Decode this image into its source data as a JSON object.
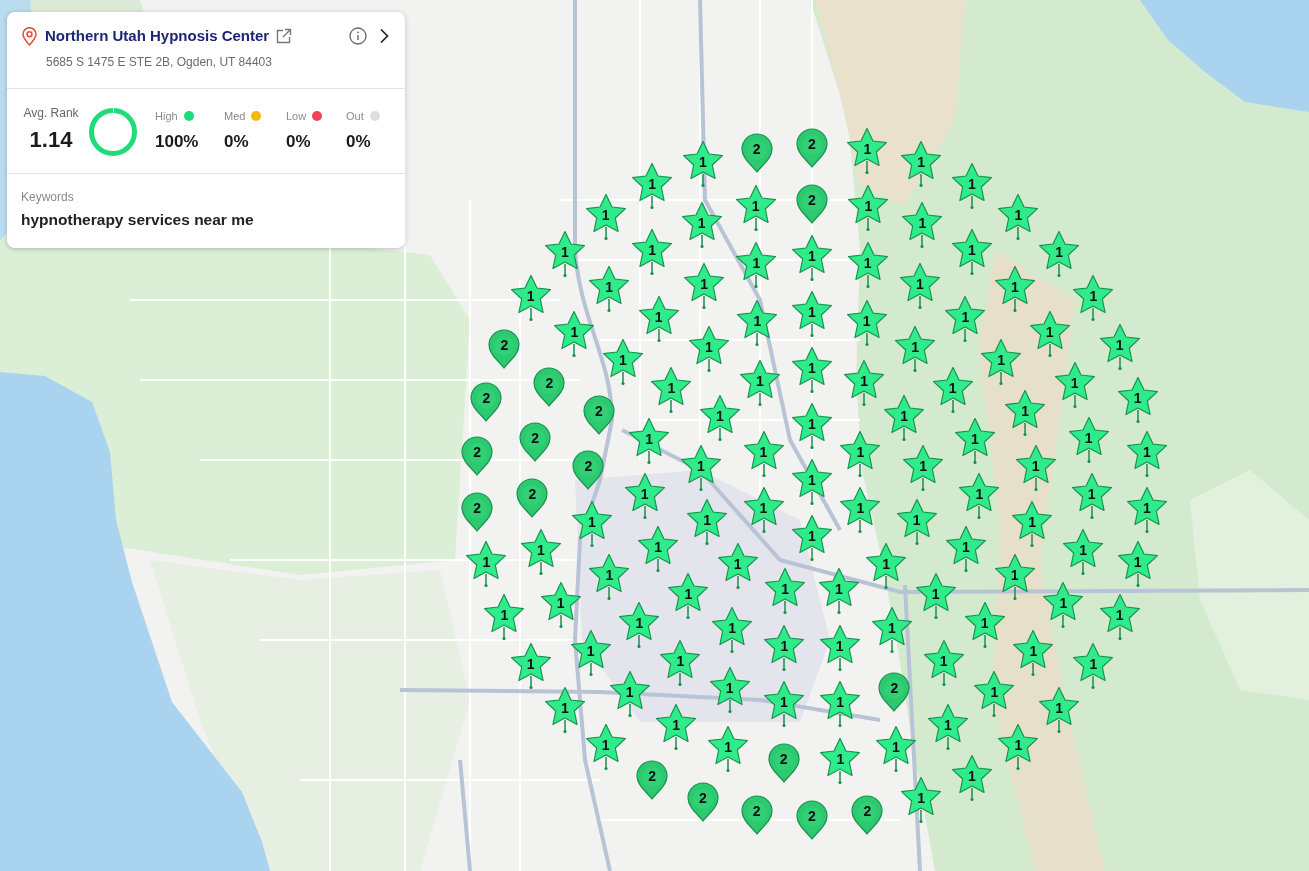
{
  "business": {
    "name": "Northern Utah Hypnosis Center",
    "address": "5685 S 1475 E STE 2B, Ogden, UT 84403"
  },
  "summary": {
    "avg_rank_label": "Avg. Rank",
    "avg_rank": "1.14",
    "donut": {
      "segments": [
        {
          "color": "#1fdc78",
          "level": 1
        }
      ]
    },
    "stats": [
      {
        "label": "High",
        "color": "#1fdc78",
        "value": "100%"
      },
      {
        "label": "Med",
        "color": "#f6b90c",
        "value": "0%"
      },
      {
        "label": "Low",
        "color": "#ee4455",
        "value": "0%"
      },
      {
        "label": "Out",
        "color": "#dcdde3",
        "value": "0%"
      }
    ]
  },
  "keywords": {
    "label": "Keywords",
    "value": "hypnotherapy services near me"
  },
  "map": {
    "rings": [
      {
        "points": [
          {
            "kind": "star",
            "label": "1"
          }
        ]
      },
      {
        "points": [
          {
            "kind": "star",
            "label": "1"
          },
          {
            "kind": "star",
            "label": "1"
          },
          {
            "kind": "star",
            "label": "1"
          },
          {
            "kind": "star",
            "label": "1"
          },
          {
            "kind": "star",
            "label": "1"
          },
          {
            "kind": "star",
            "label": "1"
          }
        ]
      },
      {
        "points": [
          {
            "kind": "star",
            "label": "1"
          },
          {
            "kind": "star",
            "label": "1"
          },
          {
            "kind": "star",
            "label": "1"
          },
          {
            "kind": "star",
            "label": "1"
          },
          {
            "kind": "star",
            "label": "1"
          },
          {
            "kind": "star",
            "label": "1"
          },
          {
            "kind": "star",
            "label": "1"
          },
          {
            "kind": "star",
            "label": "1"
          },
          {
            "kind": "star",
            "label": "1"
          },
          {
            "kind": "star",
            "label": "1"
          },
          {
            "kind": "star",
            "label": "1"
          },
          {
            "kind": "star",
            "label": "1"
          },
          {
            "kind": "star",
            "label": "1"
          }
        ]
      },
      {
        "points": [
          {
            "kind": "star",
            "label": "1"
          },
          {
            "kind": "star",
            "label": "1"
          },
          {
            "kind": "star",
            "label": "1"
          },
          {
            "kind": "star",
            "label": "1"
          },
          {
            "kind": "star",
            "label": "1"
          },
          {
            "kind": "star",
            "label": "1"
          },
          {
            "kind": "star",
            "label": "1"
          },
          {
            "kind": "star",
            "label": "1"
          },
          {
            "kind": "star",
            "label": "1"
          },
          {
            "kind": "star",
            "label": "1"
          },
          {
            "kind": "star",
            "label": "1"
          },
          {
            "kind": "star",
            "label": "1"
          },
          {
            "kind": "star",
            "label": "1"
          },
          {
            "kind": "star",
            "label": "1"
          },
          {
            "kind": "star",
            "label": "1"
          },
          {
            "kind": "star",
            "label": "1"
          },
          {
            "kind": "star",
            "label": "1"
          },
          {
            "kind": "star",
            "label": "1"
          },
          {
            "kind": "star",
            "label": "1"
          }
        ]
      },
      {
        "points": [
          {
            "kind": "star",
            "label": "1"
          },
          {
            "kind": "star",
            "label": "1"
          },
          {
            "kind": "star",
            "label": "1"
          },
          {
            "kind": "star",
            "label": "1"
          },
          {
            "kind": "star",
            "label": "1"
          },
          {
            "kind": "star",
            "label": "1"
          },
          {
            "kind": "star",
            "label": "1"
          },
          {
            "kind": "star",
            "label": "1"
          },
          {
            "kind": "star",
            "label": "1"
          },
          {
            "kind": "star",
            "label": "1"
          },
          {
            "kind": "star",
            "label": "1"
          },
          {
            "kind": "pin",
            "label": "2"
          },
          {
            "kind": "star",
            "label": "1"
          },
          {
            "kind": "star",
            "label": "1"
          },
          {
            "kind": "star",
            "label": "1"
          },
          {
            "kind": "star",
            "label": "1"
          },
          {
            "kind": "star",
            "label": "1"
          },
          {
            "kind": "star",
            "label": "1"
          },
          {
            "kind": "star",
            "label": "1"
          },
          {
            "kind": "pin",
            "label": "2"
          },
          {
            "kind": "pin",
            "label": "2"
          },
          {
            "kind": "star",
            "label": "1"
          },
          {
            "kind": "star",
            "label": "1"
          },
          {
            "kind": "star",
            "label": "1"
          },
          {
            "kind": "star",
            "label": "1"
          }
        ]
      },
      {
        "points": [
          {
            "kind": "pin",
            "label": "2"
          },
          {
            "kind": "star",
            "label": "1"
          },
          {
            "kind": "star",
            "label": "1"
          },
          {
            "kind": "star",
            "label": "1"
          },
          {
            "kind": "star",
            "label": "1"
          },
          {
            "kind": "star",
            "label": "1"
          },
          {
            "kind": "star",
            "label": "1"
          },
          {
            "kind": "star",
            "label": "1"
          },
          {
            "kind": "star",
            "label": "1"
          },
          {
            "kind": "star",
            "label": "1"
          },
          {
            "kind": "star",
            "label": "1"
          },
          {
            "kind": "star",
            "label": "1"
          },
          {
            "kind": "star",
            "label": "1"
          },
          {
            "kind": "star",
            "label": "1"
          },
          {
            "kind": "star",
            "label": "1"
          },
          {
            "kind": "star",
            "label": "1"
          },
          {
            "kind": "pin",
            "label": "2"
          },
          {
            "kind": "star",
            "label": "1"
          },
          {
            "kind": "star",
            "label": "1"
          },
          {
            "kind": "star",
            "label": "1"
          },
          {
            "kind": "star",
            "label": "1"
          },
          {
            "kind": "star",
            "label": "1"
          },
          {
            "kind": "star",
            "label": "1"
          },
          {
            "kind": "pin",
            "label": "2"
          },
          {
            "kind": "pin",
            "label": "2"
          },
          {
            "kind": "pin",
            "label": "2"
          },
          {
            "kind": "star",
            "label": "1"
          },
          {
            "kind": "star",
            "label": "1"
          },
          {
            "kind": "star",
            "label": "1"
          },
          {
            "kind": "star",
            "label": "1"
          },
          {
            "kind": "star",
            "label": "1"
          }
        ]
      },
      {
        "points": [
          {
            "kind": "pin",
            "label": "2"
          },
          {
            "kind": "star",
            "label": "1"
          },
          {
            "kind": "star",
            "label": "1"
          },
          {
            "kind": "star",
            "label": "1"
          },
          {
            "kind": "star",
            "label": "1"
          },
          {
            "kind": "star",
            "label": "1"
          },
          {
            "kind": "star",
            "label": "1"
          },
          {
            "kind": "star",
            "label": "1"
          },
          {
            "kind": "star",
            "label": "1"
          },
          {
            "kind": "star",
            "label": "1"
          },
          {
            "kind": "star",
            "label": "1"
          },
          {
            "kind": "star",
            "label": "1"
          },
          {
            "kind": "star",
            "label": "1"
          },
          {
            "kind": "star",
            "label": "1"
          },
          {
            "kind": "star",
            "label": "1"
          },
          {
            "kind": "star",
            "label": "1"
          },
          {
            "kind": "star",
            "label": "1"
          },
          {
            "kind": "star",
            "label": "1"
          },
          {
            "kind": "pin",
            "label": "2"
          },
          {
            "kind": "pin",
            "label": "2"
          },
          {
            "kind": "pin",
            "label": "2"
          },
          {
            "kind": "pin",
            "label": "2"
          },
          {
            "kind": "pin",
            "label": "2"
          },
          {
            "kind": "star",
            "label": "1"
          },
          {
            "kind": "star",
            "label": "1"
          },
          {
            "kind": "star",
            "label": "1"
          },
          {
            "kind": "star",
            "label": "1"
          },
          {
            "kind": "star",
            "label": "1"
          },
          {
            "kind": "pin",
            "label": "2"
          },
          {
            "kind": "pin",
            "label": "2"
          },
          {
            "kind": "pin",
            "label": "2"
          },
          {
            "kind": "pin",
            "label": "2"
          },
          {
            "kind": "star",
            "label": "1"
          },
          {
            "kind": "star",
            "label": "1"
          },
          {
            "kind": "star",
            "label": "1"
          },
          {
            "kind": "star",
            "label": "1"
          },
          {
            "kind": "star",
            "label": "1"
          },
          {
            "kind": "pin",
            "label": "2"
          }
        ]
      }
    ]
  }
}
